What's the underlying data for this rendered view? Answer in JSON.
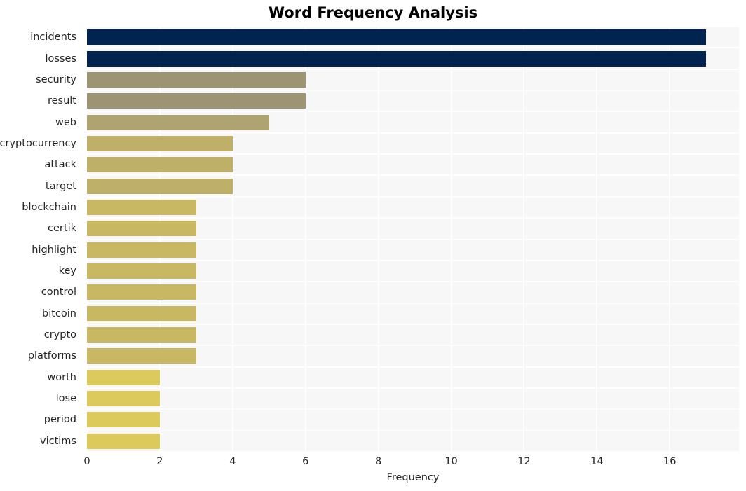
{
  "chart_data": {
    "type": "bar",
    "orientation": "horizontal",
    "title": "Word Frequency Analysis",
    "xlabel": "Frequency",
    "ylabel": "",
    "xlim": [
      0,
      17.9
    ],
    "xticks": [
      0,
      2,
      4,
      6,
      8,
      10,
      12,
      14,
      16
    ],
    "xtick_labels": [
      "0",
      "2",
      "4",
      "6",
      "8",
      "10",
      "12",
      "14",
      "16"
    ],
    "grid": true,
    "legend": false,
    "categories": [
      "incidents",
      "losses",
      "security",
      "result",
      "web",
      "cryptocurrency",
      "attack",
      "target",
      "blockchain",
      "certik",
      "highlight",
      "key",
      "control",
      "bitcoin",
      "crypto",
      "platforms",
      "worth",
      "lose",
      "period",
      "victims"
    ],
    "values": [
      17,
      17,
      6,
      6,
      5,
      4,
      4,
      4,
      3,
      3,
      3,
      3,
      3,
      3,
      3,
      3,
      2,
      2,
      2,
      2
    ],
    "bar_colors": [
      "#00234f",
      "#00234f",
      "#9c9472",
      "#9c9472",
      "#ada472",
      "#bfb069",
      "#bfb069",
      "#bfb069",
      "#c9b863",
      "#c9b863",
      "#c9b863",
      "#c9b863",
      "#c9b863",
      "#c9b863",
      "#c9b863",
      "#c9b863",
      "#ddca5c",
      "#ddca5c",
      "#ddca5c",
      "#ddca5c"
    ],
    "plot_background": "#f7f7f7",
    "gridline_color": "#ffffff",
    "title_color": "#000000",
    "tick_color": "#262626"
  }
}
